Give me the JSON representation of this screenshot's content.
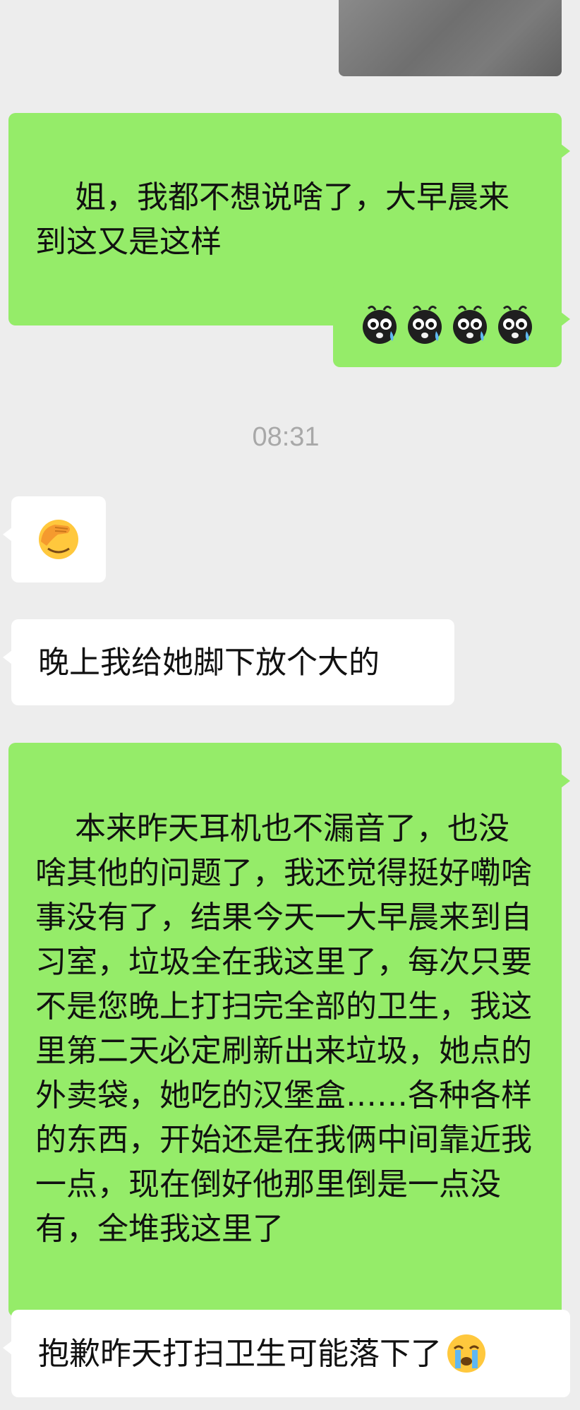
{
  "messages": [
    {
      "text": "姐，我都不想说啥了，大早晨来到这又是这样"
    },
    {
      "emoji_count": 4,
      "emoji_icon": "crying-bug-eyed-sticker"
    },
    {
      "timestamp": "08:31"
    },
    {
      "emoji_icon": "face-palm-emoji"
    },
    {
      "text": "晚上我给她脚下放个大的"
    },
    {
      "text": "本来昨天耳机也不漏音了，也没啥其他的问题了，我还觉得挺好嘞啥事没有了，结果今天一大早晨来到自习室，垃圾全在我这里了，每次只要不是您晚上打扫完全部的卫生，我这里第二天必定刷新出来垃圾，她点的外卖袋，她吃的汉堡盒……各种各样的东西，开始还是在我俩中间靠近我一点，现在倒好他那里倒是一点没有，全堆我这里了"
    },
    {
      "text": "抱歉昨天打扫卫生可能落下了",
      "emoji_icon": "loudly-crying-face-emoji"
    }
  ],
  "colors": {
    "sent_bubble": "#95ec69",
    "received_bubble": "#ffffff",
    "background": "#ededed"
  }
}
